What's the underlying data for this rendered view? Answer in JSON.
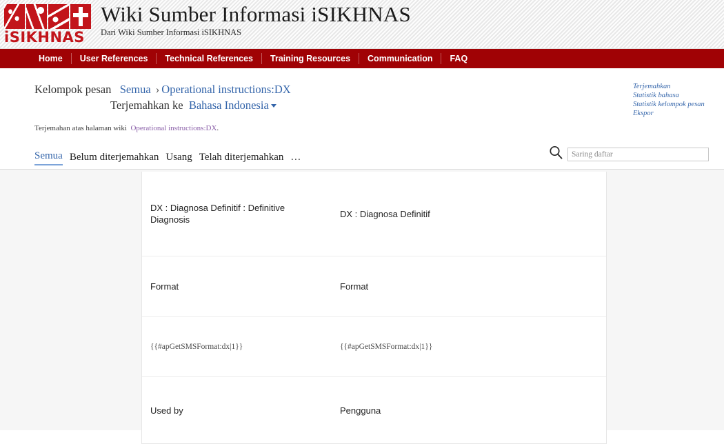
{
  "header": {
    "logo_word": "iSIKHNAS",
    "logo_icon": "isikhnas-logo",
    "title": "Wiki Sumber Informasi iSIKHNAS",
    "tagline": "Dari Wiki Sumber Informasi iSIKHNAS",
    "nav": [
      {
        "label": "Home"
      },
      {
        "label": "User References"
      },
      {
        "label": "Technical References"
      },
      {
        "label": "Training Resources"
      },
      {
        "label": "Communication"
      },
      {
        "label": "FAQ"
      }
    ]
  },
  "breadcrumb": {
    "group_label": "Kelompok pesan",
    "all_link": "Semua",
    "separator": "›",
    "page_link": "Operational instructions:DX",
    "translate_to_label": "Terjemahkan ke",
    "language": "Bahasa Indonesia"
  },
  "subnote": {
    "prefix": "Terjemahan atas halaman wiki",
    "page": "Operational instructions:DX",
    "suffix": "."
  },
  "right_rail": [
    {
      "label": "Terjemahkan"
    },
    {
      "label": "Statistik bahasa"
    },
    {
      "label": "Statistik kelompok pesan"
    },
    {
      "label": "Ekspor"
    }
  ],
  "filters": {
    "tabs": [
      {
        "label": "Semua",
        "active": true
      },
      {
        "label": "Belum diterjemahkan",
        "active": false
      },
      {
        "label": "Usang",
        "active": false
      },
      {
        "label": "Telah diterjemahkan",
        "active": false
      },
      {
        "label": "…",
        "active": false
      }
    ],
    "search_placeholder": "Saring daftar",
    "search_value": "",
    "search_icon": "search-icon"
  },
  "table": {
    "rows": [
      {
        "source": "DX : Diagnosa Definitif : Definitive Diagnosis",
        "target": "DX : Diagnosa Definitif",
        "style": "normal"
      },
      {
        "source": "Format",
        "target": "Format",
        "style": "normal"
      },
      {
        "source": "{{#apGetSMSFormat:dx|1}}",
        "target": "{{#apGetSMSFormat:dx|1}}",
        "style": "code"
      },
      {
        "source": "Used by",
        "target": "Pengguna",
        "style": "normal"
      }
    ]
  },
  "colors": {
    "brand_red": "#a00205",
    "logo_red": "#c2151b",
    "link_blue": "#3465aa",
    "visited_purple": "#8a5fa8",
    "panel_gray": "#f6f6f6"
  }
}
